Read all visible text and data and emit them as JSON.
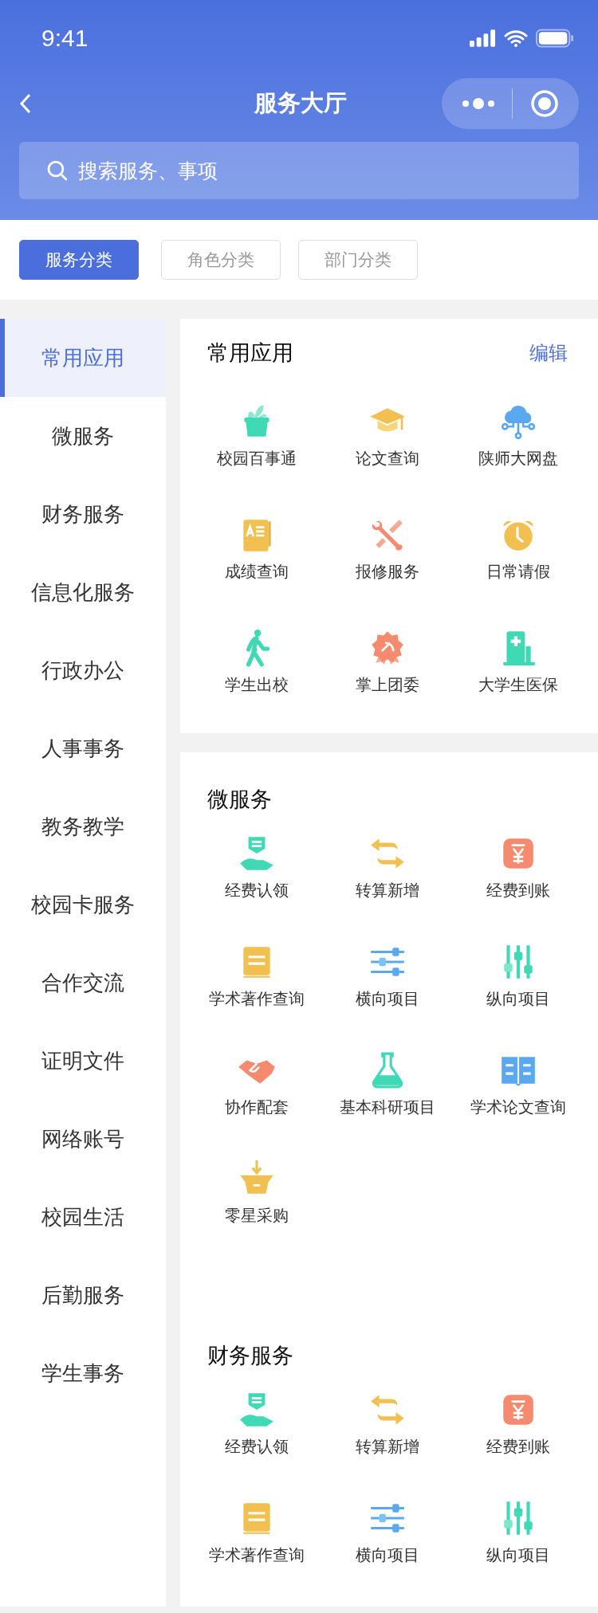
{
  "status_bar": {
    "time": "9:41"
  },
  "nav": {
    "title": "服务大厅"
  },
  "search": {
    "placeholder": "搜索服务、事项"
  },
  "tabs": [
    {
      "label": "服务分类",
      "selected": true
    },
    {
      "label": "角色分类",
      "selected": false
    },
    {
      "label": "部门分类",
      "selected": false
    }
  ],
  "sidebar": {
    "items": [
      {
        "label": "常用应用",
        "selected": true
      },
      {
        "label": "微服务",
        "selected": false
      },
      {
        "label": "财务服务",
        "selected": false
      },
      {
        "label": "信息化服务",
        "selected": false
      },
      {
        "label": "行政办公",
        "selected": false
      },
      {
        "label": "人事事务",
        "selected": false
      },
      {
        "label": "教务教学",
        "selected": false
      },
      {
        "label": "校园卡服务",
        "selected": false
      },
      {
        "label": "合作交流",
        "selected": false
      },
      {
        "label": "证明文件",
        "selected": false
      },
      {
        "label": "网络账号",
        "selected": false
      },
      {
        "label": "校园生活",
        "selected": false
      },
      {
        "label": "后勤服务",
        "selected": false
      },
      {
        "label": "学生事务",
        "selected": false
      }
    ]
  },
  "panels": [
    {
      "sections": [
        {
          "title": "常用应用",
          "action": "编辑",
          "items": [
            {
              "label": "校园百事通"
            },
            {
              "label": "论文查询"
            },
            {
              "label": "陕师大网盘"
            },
            {
              "label": "成绩查询"
            },
            {
              "label": "报修服务"
            },
            {
              "label": "日常请假"
            },
            {
              "label": "学生出校"
            },
            {
              "label": "掌上团委"
            },
            {
              "label": "大学生医保"
            }
          ]
        }
      ]
    },
    {
      "sections": [
        {
          "title": "微服务",
          "items": [
            {
              "label": "经费认领"
            },
            {
              "label": "转算新增"
            },
            {
              "label": "经费到账"
            },
            {
              "label": "学术著作查询"
            },
            {
              "label": "横向项目"
            },
            {
              "label": "纵向项目"
            },
            {
              "label": "协作配套"
            },
            {
              "label": "基本科研项目"
            },
            {
              "label": "学术论文查询"
            },
            {
              "label": "零星采购"
            }
          ]
        },
        {
          "title": "财务服务",
          "items": [
            {
              "label": "经费认领"
            },
            {
              "label": "转算新增"
            },
            {
              "label": "经费到账"
            },
            {
              "label": "学术著作查询"
            },
            {
              "label": "横向项目"
            },
            {
              "label": "纵向项目"
            }
          ]
        }
      ]
    }
  ]
}
